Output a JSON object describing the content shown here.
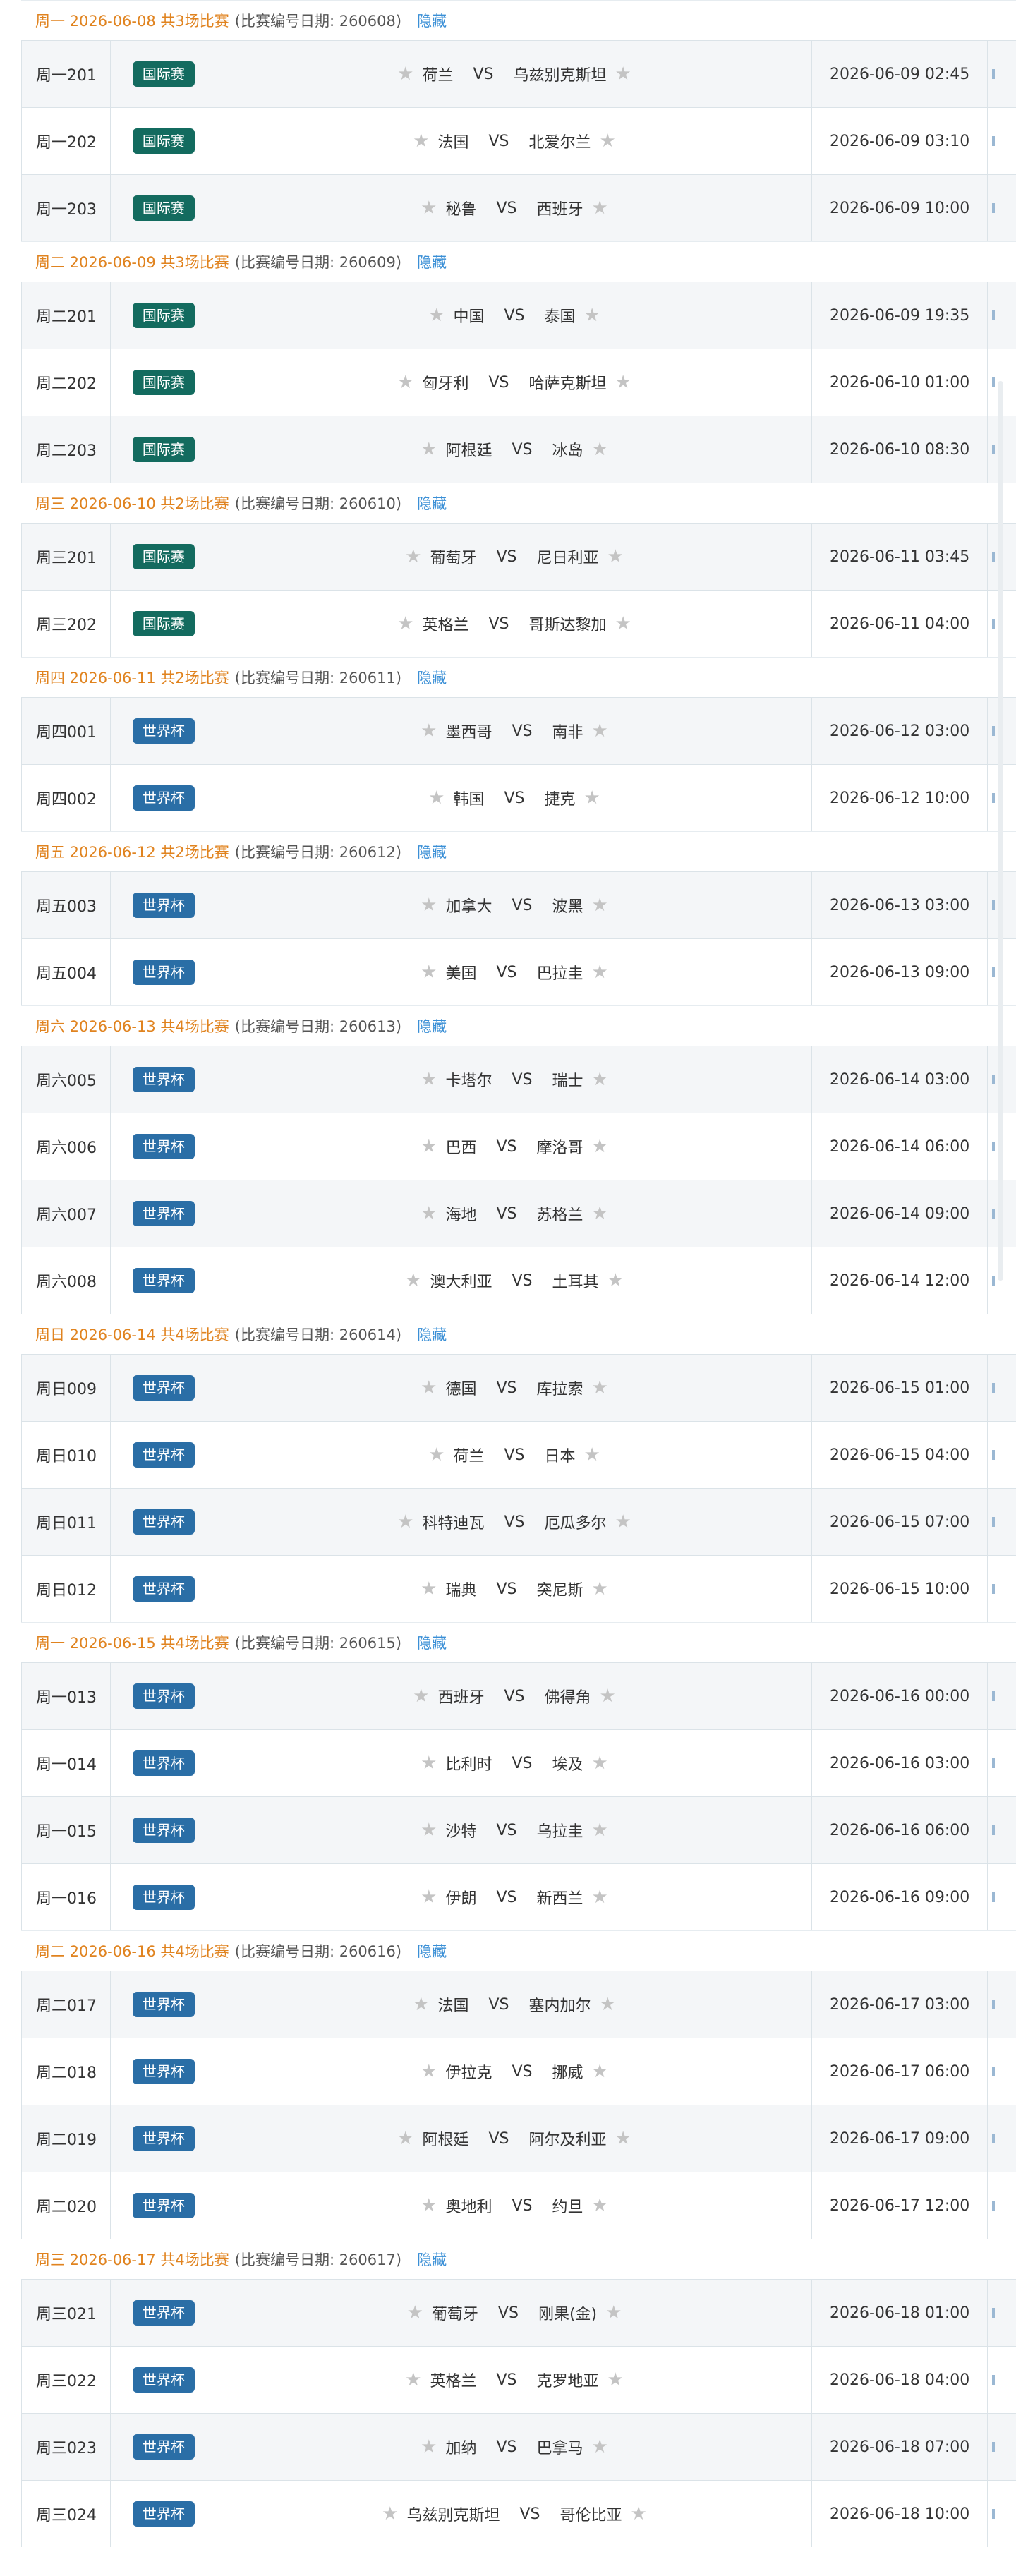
{
  "groups": [
    {
      "title": "周一 2026-06-08 共3场比赛",
      "code": "(比赛编号日期: 260608)",
      "hide": "隐藏",
      "matches": [
        {
          "num": "周一201",
          "league": "国际赛",
          "league_type": "intl",
          "home": "荷兰",
          "vs": "VS",
          "away": "乌兹别克斯坦",
          "time": "2026-06-09 02:45"
        },
        {
          "num": "周一202",
          "league": "国际赛",
          "league_type": "intl",
          "home": "法国",
          "vs": "VS",
          "away": "北爱尔兰",
          "time": "2026-06-09 03:10"
        },
        {
          "num": "周一203",
          "league": "国际赛",
          "league_type": "intl",
          "home": "秘鲁",
          "vs": "VS",
          "away": "西班牙",
          "time": "2026-06-09 10:00"
        }
      ]
    },
    {
      "title": "周二 2026-06-09 共3场比赛",
      "code": "(比赛编号日期: 260609)",
      "hide": "隐藏",
      "matches": [
        {
          "num": "周二201",
          "league": "国际赛",
          "league_type": "intl",
          "home": "中国",
          "vs": "VS",
          "away": "泰国",
          "time": "2026-06-09 19:35"
        },
        {
          "num": "周二202",
          "league": "国际赛",
          "league_type": "intl",
          "home": "匈牙利",
          "vs": "VS",
          "away": "哈萨克斯坦",
          "time": "2026-06-10 01:00"
        },
        {
          "num": "周二203",
          "league": "国际赛",
          "league_type": "intl",
          "home": "阿根廷",
          "vs": "VS",
          "away": "冰岛",
          "time": "2026-06-10 08:30"
        }
      ]
    },
    {
      "title": "周三 2026-06-10 共2场比赛",
      "code": "(比赛编号日期: 260610)",
      "hide": "隐藏",
      "matches": [
        {
          "num": "周三201",
          "league": "国际赛",
          "league_type": "intl",
          "home": "葡萄牙",
          "vs": "VS",
          "away": "尼日利亚",
          "time": "2026-06-11 03:45"
        },
        {
          "num": "周三202",
          "league": "国际赛",
          "league_type": "intl",
          "home": "英格兰",
          "vs": "VS",
          "away": "哥斯达黎加",
          "time": "2026-06-11 04:00"
        }
      ]
    },
    {
      "title": "周四 2026-06-11 共2场比赛",
      "code": "(比赛编号日期: 260611)",
      "hide": "隐藏",
      "matches": [
        {
          "num": "周四001",
          "league": "世界杯",
          "league_type": "wc",
          "home": "墨西哥",
          "vs": "VS",
          "away": "南非",
          "time": "2026-06-12 03:00"
        },
        {
          "num": "周四002",
          "league": "世界杯",
          "league_type": "wc",
          "home": "韩国",
          "vs": "VS",
          "away": "捷克",
          "time": "2026-06-12 10:00"
        }
      ]
    },
    {
      "title": "周五 2026-06-12 共2场比赛",
      "code": "(比赛编号日期: 260612)",
      "hide": "隐藏",
      "matches": [
        {
          "num": "周五003",
          "league": "世界杯",
          "league_type": "wc",
          "home": "加拿大",
          "vs": "VS",
          "away": "波黑",
          "time": "2026-06-13 03:00"
        },
        {
          "num": "周五004",
          "league": "世界杯",
          "league_type": "wc",
          "home": "美国",
          "vs": "VS",
          "away": "巴拉圭",
          "time": "2026-06-13 09:00"
        }
      ]
    },
    {
      "title": "周六 2026-06-13 共4场比赛",
      "code": "(比赛编号日期: 260613)",
      "hide": "隐藏",
      "matches": [
        {
          "num": "周六005",
          "league": "世界杯",
          "league_type": "wc",
          "home": "卡塔尔",
          "vs": "VS",
          "away": "瑞士",
          "time": "2026-06-14 03:00"
        },
        {
          "num": "周六006",
          "league": "世界杯",
          "league_type": "wc",
          "home": "巴西",
          "vs": "VS",
          "away": "摩洛哥",
          "time": "2026-06-14 06:00"
        },
        {
          "num": "周六007",
          "league": "世界杯",
          "league_type": "wc",
          "home": "海地",
          "vs": "VS",
          "away": "苏格兰",
          "time": "2026-06-14 09:00"
        },
        {
          "num": "周六008",
          "league": "世界杯",
          "league_type": "wc",
          "home": "澳大利亚",
          "vs": "VS",
          "away": "土耳其",
          "time": "2026-06-14 12:00"
        }
      ]
    },
    {
      "title": "周日 2026-06-14 共4场比赛",
      "code": "(比赛编号日期: 260614)",
      "hide": "隐藏",
      "matches": [
        {
          "num": "周日009",
          "league": "世界杯",
          "league_type": "wc",
          "home": "德国",
          "vs": "VS",
          "away": "库拉索",
          "time": "2026-06-15 01:00"
        },
        {
          "num": "周日010",
          "league": "世界杯",
          "league_type": "wc",
          "home": "荷兰",
          "vs": "VS",
          "away": "日本",
          "time": "2026-06-15 04:00"
        },
        {
          "num": "周日011",
          "league": "世界杯",
          "league_type": "wc",
          "home": "科特迪瓦",
          "vs": "VS",
          "away": "厄瓜多尔",
          "time": "2026-06-15 07:00"
        },
        {
          "num": "周日012",
          "league": "世界杯",
          "league_type": "wc",
          "home": "瑞典",
          "vs": "VS",
          "away": "突尼斯",
          "time": "2026-06-15 10:00"
        }
      ]
    },
    {
      "title": "周一 2026-06-15 共4场比赛",
      "code": "(比赛编号日期: 260615)",
      "hide": "隐藏",
      "matches": [
        {
          "num": "周一013",
          "league": "世界杯",
          "league_type": "wc",
          "home": "西班牙",
          "vs": "VS",
          "away": "佛得角",
          "time": "2026-06-16 00:00"
        },
        {
          "num": "周一014",
          "league": "世界杯",
          "league_type": "wc",
          "home": "比利时",
          "vs": "VS",
          "away": "埃及",
          "time": "2026-06-16 03:00"
        },
        {
          "num": "周一015",
          "league": "世界杯",
          "league_type": "wc",
          "home": "沙特",
          "vs": "VS",
          "away": "乌拉圭",
          "time": "2026-06-16 06:00"
        },
        {
          "num": "周一016",
          "league": "世界杯",
          "league_type": "wc",
          "home": "伊朗",
          "vs": "VS",
          "away": "新西兰",
          "time": "2026-06-16 09:00"
        }
      ]
    },
    {
      "title": "周二 2026-06-16 共4场比赛",
      "code": "(比赛编号日期: 260616)",
      "hide": "隐藏",
      "matches": [
        {
          "num": "周二017",
          "league": "世界杯",
          "league_type": "wc",
          "home": "法国",
          "vs": "VS",
          "away": "塞内加尔",
          "time": "2026-06-17 03:00"
        },
        {
          "num": "周二018",
          "league": "世界杯",
          "league_type": "wc",
          "home": "伊拉克",
          "vs": "VS",
          "away": "挪威",
          "time": "2026-06-17 06:00"
        },
        {
          "num": "周二019",
          "league": "世界杯",
          "league_type": "wc",
          "home": "阿根廷",
          "vs": "VS",
          "away": "阿尔及利亚",
          "time": "2026-06-17 09:00"
        },
        {
          "num": "周二020",
          "league": "世界杯",
          "league_type": "wc",
          "home": "奥地利",
          "vs": "VS",
          "away": "约旦",
          "time": "2026-06-17 12:00"
        }
      ]
    },
    {
      "title": "周三 2026-06-17 共4场比赛",
      "code": "(比赛编号日期: 260617)",
      "hide": "隐藏",
      "matches": [
        {
          "num": "周三021",
          "league": "世界杯",
          "league_type": "wc",
          "home": "葡萄牙",
          "vs": "VS",
          "away": "刚果(金)",
          "time": "2026-06-18 01:00"
        },
        {
          "num": "周三022",
          "league": "世界杯",
          "league_type": "wc",
          "home": "英格兰",
          "vs": "VS",
          "away": "克罗地亚",
          "time": "2026-06-18 04:00"
        },
        {
          "num": "周三023",
          "league": "世界杯",
          "league_type": "wc",
          "home": "加纳",
          "vs": "VS",
          "away": "巴拿马",
          "time": "2026-06-18 07:00"
        },
        {
          "num": "周三024",
          "league": "世界杯",
          "league_type": "wc",
          "home": "乌兹别克斯坦",
          "vs": "VS",
          "away": "哥伦比亚",
          "time": "2026-06-18 10:00"
        }
      ]
    }
  ],
  "icons": {
    "favorite_star": "star-icon"
  },
  "colors": {
    "header_title": "#e0831f",
    "hide_link": "#3a8fd6",
    "intl_badge": "#136b5f",
    "wc_badge": "#2a6ea6",
    "star": "#c4c4c4"
  }
}
